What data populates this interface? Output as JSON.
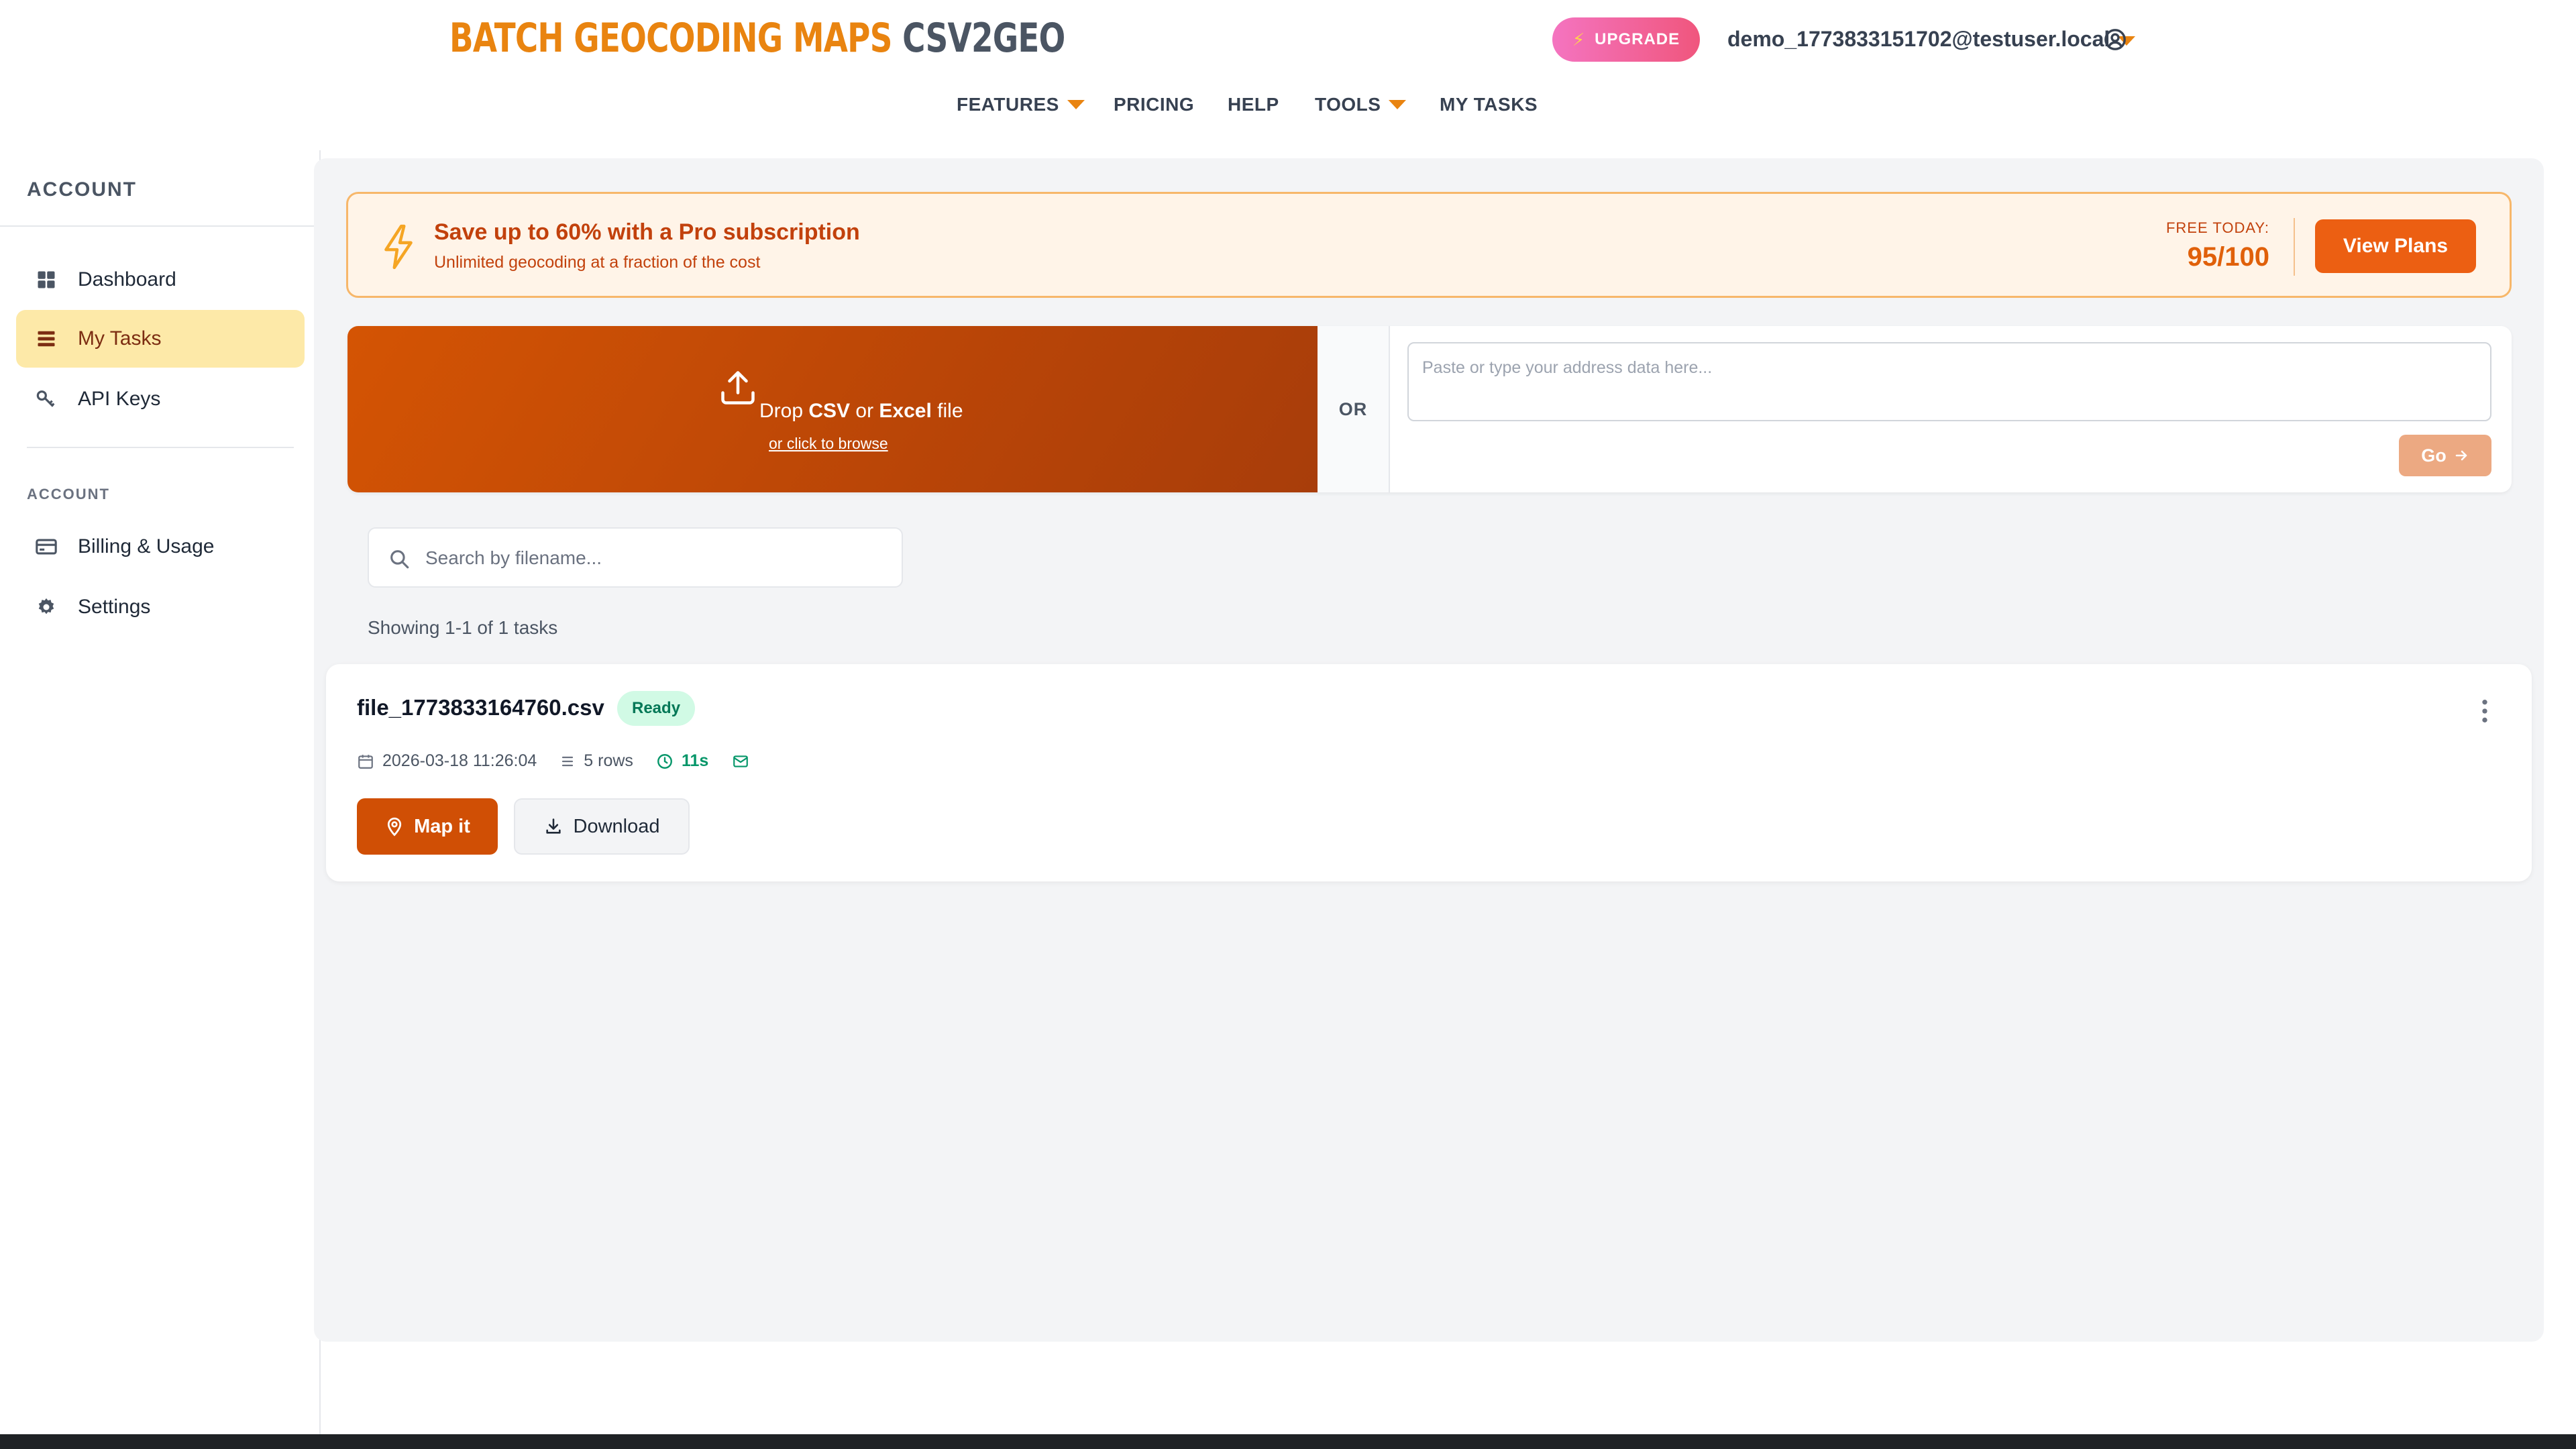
{
  "header": {
    "logo_part1": "BATCH GEOCODING MAPS",
    "logo_part2": "CSV2GEO",
    "upgrade_label": "UPGRADE",
    "user_email": "demo_1773833151702@testuser.local"
  },
  "nav": {
    "items": [
      "FEATURES",
      "PRICING",
      "HELP",
      "TOOLS",
      "MY TASKS"
    ]
  },
  "sidebar": {
    "title": "ACCOUNT",
    "items": [
      {
        "label": "Dashboard",
        "icon": "grid-icon"
      },
      {
        "label": "My Tasks",
        "icon": "tasks-icon",
        "active": true
      },
      {
        "label": "API Keys",
        "icon": "key-icon"
      }
    ],
    "section2_title": "ACCOUNT",
    "items2": [
      {
        "label": "Billing & Usage",
        "icon": "credit-card-icon"
      },
      {
        "label": "Settings",
        "icon": "gear-icon"
      }
    ]
  },
  "promo": {
    "title": "Save up to 60% with a Pro subscription",
    "subtitle": "Unlimited geocoding at a fraction of the cost",
    "free_label": "FREE TODAY:",
    "free_value": "95/100",
    "button_label": "View Plans"
  },
  "upload": {
    "drop_prefix": "Drop ",
    "drop_csv": "CSV",
    "drop_or": " or ",
    "drop_excel": "Excel",
    "drop_suffix": " file",
    "browse_link": "or click to browse",
    "or_label": "OR",
    "paste_placeholder": "Paste or type your address data here...",
    "go_label": "Go"
  },
  "search": {
    "placeholder": "Search by filename..."
  },
  "showing_text": "Showing 1-1 of 1 tasks",
  "tasks": [
    {
      "filename": "file_1773833164760.csv",
      "status": "Ready",
      "date": "2026-03-18 11:26:04",
      "rows": "5 rows",
      "duration": "11s",
      "map_label": "Map it",
      "download_label": "Download"
    }
  ],
  "colors": {
    "brand_orange": "#e98410",
    "accent": "#d04f05",
    "active_bg": "#fde9a8",
    "status_ready_bg": "#d1fae5"
  }
}
